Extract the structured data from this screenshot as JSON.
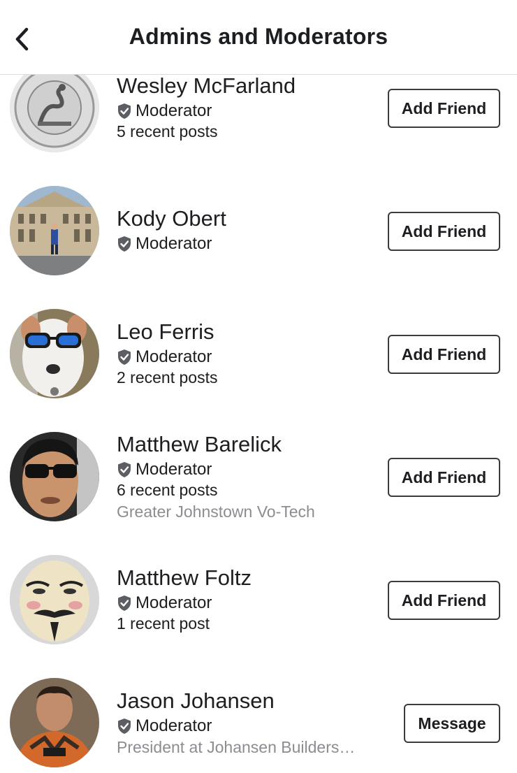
{
  "header": {
    "title": "Admins and Moderators"
  },
  "members": [
    {
      "name": "Wesley McFarland",
      "role": "Moderator",
      "posts": "5 recent posts",
      "sub": "",
      "action": "Add Friend"
    },
    {
      "name": "Kody Obert",
      "role": "Moderator",
      "posts": "",
      "sub": "",
      "action": "Add Friend"
    },
    {
      "name": "Leo Ferris",
      "role": "Moderator",
      "posts": "2 recent posts",
      "sub": "",
      "action": "Add Friend"
    },
    {
      "name": "Matthew Barelick",
      "role": "Moderator",
      "posts": "6 recent posts",
      "sub": "Greater Johnstown Vo-Tech",
      "action": "Add Friend"
    },
    {
      "name": "Matthew Foltz",
      "role": "Moderator",
      "posts": "1 recent post",
      "sub": "",
      "action": "Add Friend"
    },
    {
      "name": "Jason Johansen",
      "role": "Moderator",
      "posts": "",
      "sub": "President at Johansen Builders…",
      "action": "Message"
    }
  ],
  "colors": {
    "text": "#1c1e21",
    "secondary": "#8a8d91",
    "badge": "#5b5e63",
    "border": "#3a3b3c"
  }
}
